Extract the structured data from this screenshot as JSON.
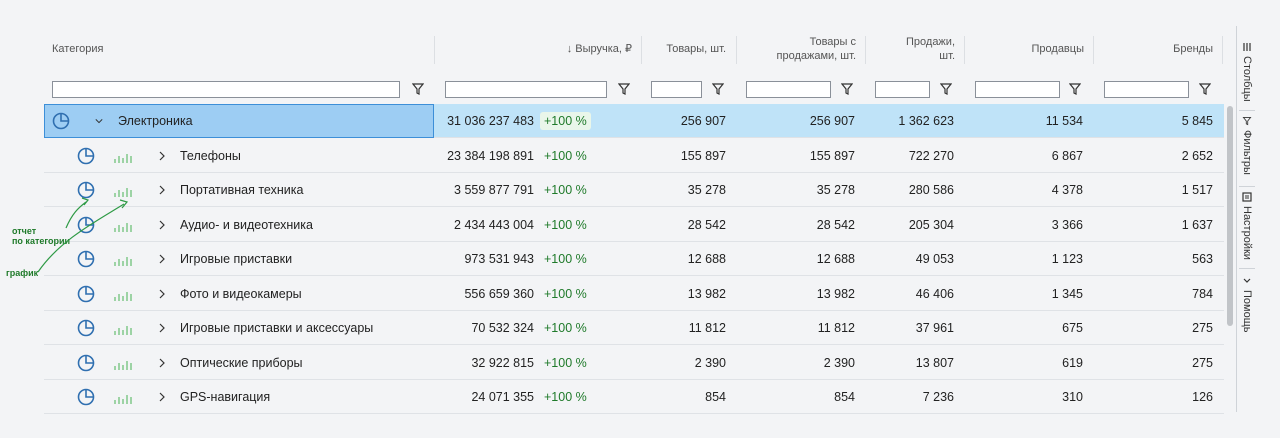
{
  "header": {
    "category": "Категория",
    "revenue": "↓ Выручка, ₽",
    "goods_line1": "Товары, шт.",
    "goods_sold_line1": "Товары с",
    "goods_sold_line2": "продажами, шт.",
    "sales_line1": "Продажи,",
    "sales_line2": "шт.",
    "sellers": "Продавцы",
    "brands": "Бренды"
  },
  "rows": [
    {
      "name": "Электроника",
      "revenue": "31 036 237 483",
      "delta": "+100 %",
      "goods": "256 907",
      "goods_sold": "256 907",
      "sales": "1 362 623",
      "sellers": "11 534",
      "brands": "5 845"
    },
    {
      "name": "Телефоны",
      "revenue": "23 384 198 891",
      "delta": "+100 %",
      "goods": "155 897",
      "goods_sold": "155 897",
      "sales": "722 270",
      "sellers": "6 867",
      "brands": "2 652"
    },
    {
      "name": "Портативная техника",
      "revenue": "3 559 877 791",
      "delta": "+100 %",
      "goods": "35 278",
      "goods_sold": "35 278",
      "sales": "280 586",
      "sellers": "4 378",
      "brands": "1 517"
    },
    {
      "name": "Аудио- и видеотехника",
      "revenue": "2 434 443 004",
      "delta": "+100 %",
      "goods": "28 542",
      "goods_sold": "28 542",
      "sales": "205 304",
      "sellers": "3 366",
      "brands": "1 637"
    },
    {
      "name": "Игровые приставки",
      "revenue": "973 531 943",
      "delta": "+100 %",
      "goods": "12 688",
      "goods_sold": "12 688",
      "sales": "49 053",
      "sellers": "1 123",
      "brands": "563"
    },
    {
      "name": "Фото и видеокамеры",
      "revenue": "556 659 360",
      "delta": "+100 %",
      "goods": "13 982",
      "goods_sold": "13 982",
      "sales": "46 406",
      "sellers": "1 345",
      "brands": "784"
    },
    {
      "name": "Игровые приставки и аксессуары",
      "revenue": "70 532 324",
      "delta": "+100 %",
      "goods": "11 812",
      "goods_sold": "11 812",
      "sales": "37 961",
      "sellers": "675",
      "brands": "275"
    },
    {
      "name": "Оптические приборы",
      "revenue": "32 922 815",
      "delta": "+100 %",
      "goods": "2 390",
      "goods_sold": "2 390",
      "sales": "13 807",
      "sellers": "619",
      "brands": "275"
    },
    {
      "name": "GPS-навигация",
      "revenue": "24 071 355",
      "delta": "+100 %",
      "goods": "854",
      "goods_sold": "854",
      "sales": "7 236",
      "sellers": "310",
      "brands": "126"
    }
  ],
  "sidebar": {
    "columns": "Столбцы",
    "filters": "Фильтры",
    "settings": "Настройки",
    "help": "Помощь"
  },
  "annotations": {
    "report_line1": "отчет",
    "report_line2": "по категории",
    "chart": "график"
  },
  "colors": {
    "accent_blue": "#2f6fb0",
    "positive_green": "#1f7a2a",
    "selected_row": "#bfe3f8"
  },
  "icons": {
    "filter": "filter-icon",
    "report": "pie-report-icon",
    "chart": "bar-chart-icon",
    "expand": "chevron-right-icon",
    "collapse": "chevron-down-icon"
  }
}
